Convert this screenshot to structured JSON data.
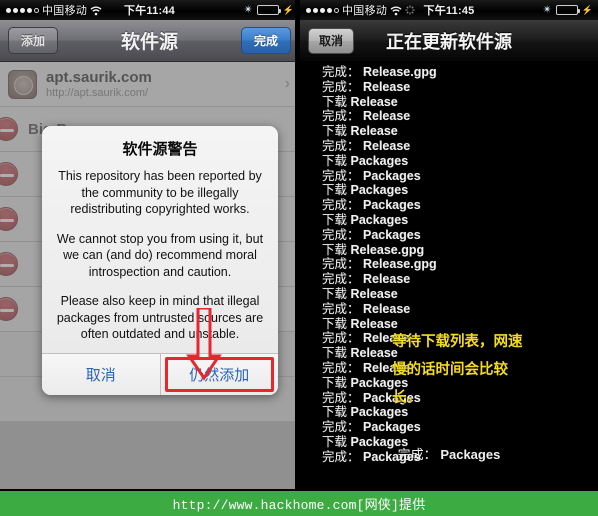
{
  "left": {
    "statusbar": {
      "signal_dots": 5,
      "signal_filled": 4,
      "carrier": "中国移动",
      "wifi_icon": "wifi-icon",
      "time": "下午11:44",
      "bluetooth_icon": "bluetooth-icon",
      "battery_icon": "battery-charging-icon",
      "battery_color": "#4cd137"
    },
    "navbar": {
      "add_label": "添加",
      "title": "软件源",
      "done_label": "完成",
      "done_color": "#3a7cc8"
    },
    "sources": [
      {
        "icon": "cydia-source-icon",
        "name": "apt.saurik.com",
        "url": "http://apt.saurik.com/",
        "chevron": "chevron-right-icon"
      }
    ],
    "edit_rows": [
      {
        "badge": "delete-minus-icon",
        "label": "Big B"
      },
      {
        "badge": "delete-minus-icon",
        "label": ""
      },
      {
        "badge": "delete-minus-icon",
        "label": ""
      },
      {
        "badge": "delete-minus-icon",
        "label": ""
      },
      {
        "badge": "delete-minus-icon",
        "label": ""
      }
    ],
    "alert": {
      "title": "软件源警告",
      "paragraphs": [
        "This repository has been reported by the community to be illegally redistributing copyrighted works.",
        "We cannot stop you from using it, but we can (and do) recommend moral introspection and caution.",
        "Please also keep in mind that illegal packages from untrusted sources are often outdated and unstable."
      ],
      "cancel_label": "取消",
      "confirm_label": "仍然添加",
      "confirm_highlight_color": "#e8262c",
      "button_text_color": "#2a64b8",
      "annotation_icon": "red-down-arrow-icon"
    }
  },
  "right": {
    "statusbar": {
      "signal_dots": 5,
      "signal_filled": 4,
      "carrier": "中国移动",
      "wifi_icon": "wifi-icon",
      "activity_icon": "activity-spinner-icon",
      "time": "下午11:45",
      "bluetooth_icon": "bluetooth-icon",
      "battery_icon": "battery-charging-icon",
      "battery_color": "#4cd137"
    },
    "navbar": {
      "cancel_label": "取消",
      "title": "正在更新软件源"
    },
    "log_lines": [
      {
        "status": "完成：",
        "file": "Release.gpg"
      },
      {
        "status": "完成：",
        "file": "Release"
      },
      {
        "status": "下载",
        "file": "Release"
      },
      {
        "status": "完成：",
        "file": "Release"
      },
      {
        "status": "下载",
        "file": "Release"
      },
      {
        "status": "完成：",
        "file": "Release"
      },
      {
        "status": "下载",
        "file": "Packages"
      },
      {
        "status": "完成：",
        "file": "Packages"
      },
      {
        "status": "下载",
        "file": "Packages"
      },
      {
        "status": "完成：",
        "file": "Packages"
      },
      {
        "status": "下载",
        "file": "Packages"
      },
      {
        "status": "完成：",
        "file": "Packages"
      },
      {
        "status": "下载",
        "file": "Release.gpg"
      },
      {
        "status": "完成：",
        "file": "Release.gpg"
      },
      {
        "status": "完成：",
        "file": "Release"
      },
      {
        "status": "下载",
        "file": "Release"
      },
      {
        "status": "完成：",
        "file": "Release"
      },
      {
        "status": "下载",
        "file": "Release"
      },
      {
        "status": "完成：",
        "file": "Release"
      },
      {
        "status": "下载",
        "file": "Release"
      },
      {
        "status": "完成：",
        "file": "Release"
      },
      {
        "status": "下载",
        "file": "Packages"
      },
      {
        "status": "完成：",
        "file": "Packages"
      },
      {
        "status": "下载",
        "file": "Packages"
      },
      {
        "status": "完成：",
        "file": "Packages"
      },
      {
        "status": "下载",
        "file": "Packages"
      },
      {
        "status": "完成：",
        "file": "Packages"
      }
    ],
    "footer_status": "完成：",
    "footer_file": "Packages",
    "annotation": {
      "color": "#f5dc20",
      "line1": "等待下载列表，网速",
      "line2": "慢的话时间会比较",
      "line3": "长。"
    }
  },
  "watermark": {
    "text": "http://www.hackhome.com[网侠]提供",
    "background": "#3bab42"
  }
}
